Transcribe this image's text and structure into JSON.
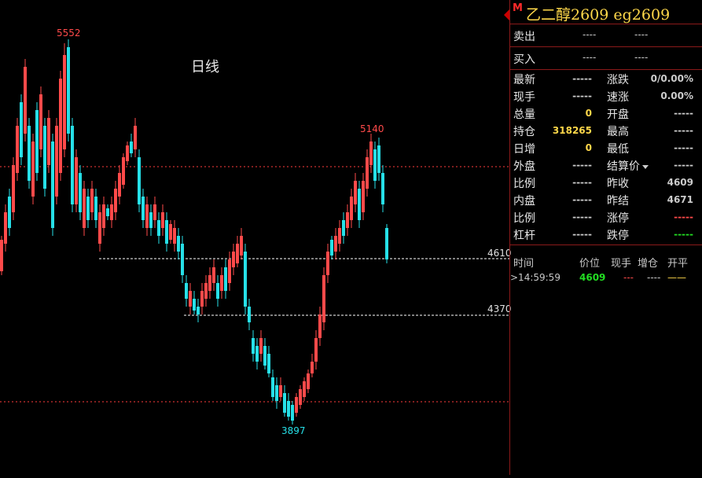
{
  "chart": {
    "period_label": "日线",
    "high_label": "5552",
    "low_label": "3897",
    "recent_high_label": "5140",
    "levels": [
      {
        "value": "4610"
      },
      {
        "value": "4370"
      }
    ],
    "colors": {
      "up": "#ff4a4a",
      "down": "#26e0e8",
      "hline": "#ff3b3b",
      "dash": "#ffffff"
    }
  },
  "panel": {
    "marker": "M",
    "title": "乙二醇2609  eg2609",
    "sell": {
      "label": "卖出",
      "price": "----",
      "qty": "----"
    },
    "buy": {
      "label": "买入",
      "price": "----",
      "qty": "----"
    },
    "rows": [
      {
        "l1": "最新",
        "v1": "-----",
        "l2": "涨跌",
        "v2": "0/0.00%"
      },
      {
        "l1": "现手",
        "v1": "-----",
        "l2": "速涨",
        "v2": "0.00%"
      },
      {
        "l1": "总量",
        "v1": "0",
        "l2": "开盘",
        "v2": "-----"
      },
      {
        "l1": "持仓",
        "v1": "318265",
        "l2": "最高",
        "v2": "-----"
      },
      {
        "l1": "日增",
        "v1": "0",
        "l2": "最低",
        "v2": "-----"
      },
      {
        "l1": "外盘",
        "v1": "-----",
        "l2": "结算价",
        "v2": "-----"
      },
      {
        "l1": "比例",
        "v1": "-----",
        "l2": "昨收",
        "v2": "4609"
      },
      {
        "l1": "内盘",
        "v1": "-----",
        "l2": "昨结",
        "v2": "4671"
      },
      {
        "l1": "比例",
        "v1": "-----",
        "l2": "涨停",
        "v2": "-----"
      },
      {
        "l1": "杠杆",
        "v1": "-----",
        "l2": "跌停",
        "v2": "-----"
      }
    ],
    "ticks_header": {
      "time": "时间",
      "price": "价位",
      "vol": "现手",
      "inc": "增仓",
      "oc": "开平"
    },
    "tick": {
      "time": ">14:59:59",
      "price": "4609",
      "vol": "---",
      "inc": "----",
      "oc": "——"
    }
  }
}
